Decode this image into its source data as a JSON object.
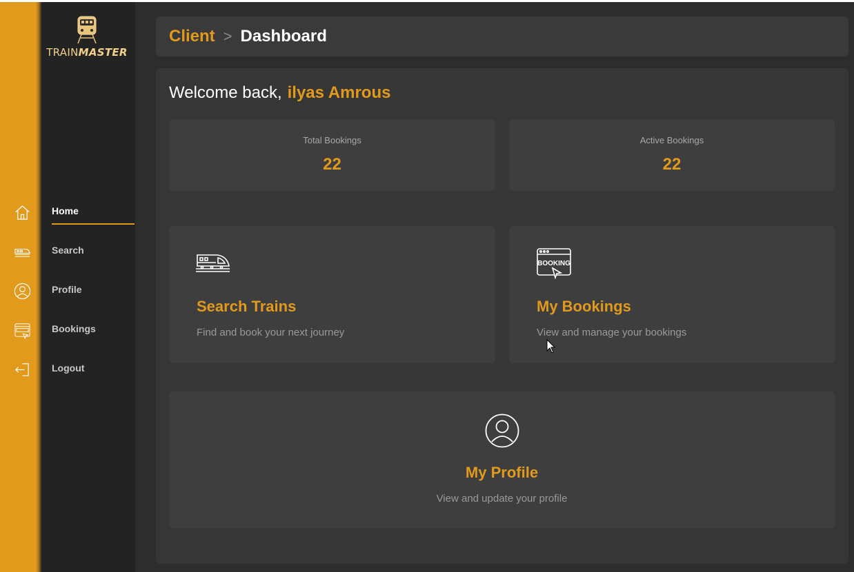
{
  "app": {
    "logo_text_a": "TRAIN",
    "logo_text_b": "MASTER"
  },
  "sidebar": {
    "items": [
      {
        "label": "Home",
        "icon": "home-icon",
        "active": true
      },
      {
        "label": "Search",
        "icon": "train-icon",
        "active": false
      },
      {
        "label": "Profile",
        "icon": "user-icon",
        "active": false
      },
      {
        "label": "Bookings",
        "icon": "booking-icon",
        "active": false
      },
      {
        "label": "Logout",
        "icon": "logout-icon",
        "active": false
      }
    ]
  },
  "header": {
    "parent": "Client",
    "separator": ">",
    "current": "Dashboard"
  },
  "welcome": {
    "prefix": "Welcome back,",
    "user_name": "ilyas Amrous"
  },
  "stats": [
    {
      "label": "Total Bookings",
      "value": "22"
    },
    {
      "label": "Active Bookings",
      "value": "22"
    }
  ],
  "cards": {
    "search": {
      "title": "Search Trains",
      "desc": "Find and book your next journey",
      "icon": "train-icon"
    },
    "bookings": {
      "title": "My Bookings",
      "desc": "View and manage your bookings",
      "icon": "booking-icon",
      "icon_text": "BOOKING"
    },
    "profile": {
      "title": "My Profile",
      "desc": "View and update your profile",
      "icon": "user-icon"
    }
  },
  "colors": {
    "accent": "#e29a1d",
    "sidebar_bg": "#232324",
    "panel_bg": "#363637",
    "card_bg": "#3e3e3f"
  }
}
